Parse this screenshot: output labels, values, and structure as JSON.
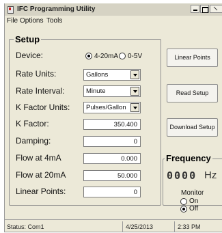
{
  "window": {
    "title": "IFC Programming Utility",
    "icon": "app-icon",
    "controls": [
      "minimize-icon",
      "maximize-icon",
      "close-icon"
    ]
  },
  "menu": {
    "file": "File",
    "options": "Options",
    "tools": "Tools"
  },
  "setup": {
    "title": "Setup",
    "device": {
      "label": "Device:",
      "options": [
        {
          "label": "4-20mA",
          "selected": true
        },
        {
          "label": "0-5V",
          "selected": false
        }
      ]
    },
    "rate_units": {
      "label": "Rate Units:",
      "value": "Gallons"
    },
    "rate_interval": {
      "label": "Rate Interval:",
      "value": "Minute"
    },
    "k_factor_units": {
      "label": "K Factor Units:",
      "value": "Pulses/Gallon"
    },
    "k_factor": {
      "label": "K Factor:",
      "value": "350.400"
    },
    "damping": {
      "label": "Damping:",
      "value": "0"
    },
    "flow_4ma": {
      "label": "Flow at 4mA",
      "value": "0.000"
    },
    "flow_20ma": {
      "label": "Flow at 20mA",
      "value": "50.000"
    },
    "linear_points": {
      "label": "Linear Points:",
      "value": "0"
    }
  },
  "buttons": {
    "linear_points": "Linear Points",
    "read_setup": "Read Setup",
    "download_setup": "Download Setup"
  },
  "frequency": {
    "title": "Frequency",
    "value": "0000",
    "unit": "Hz",
    "monitor": {
      "title": "Monitor",
      "options": [
        {
          "label": "On",
          "selected": false
        },
        {
          "label": "Off",
          "selected": true
        }
      ]
    }
  },
  "status": {
    "text": "Status: Com1",
    "date": "4/25/2013",
    "time": "2:33 PM"
  }
}
